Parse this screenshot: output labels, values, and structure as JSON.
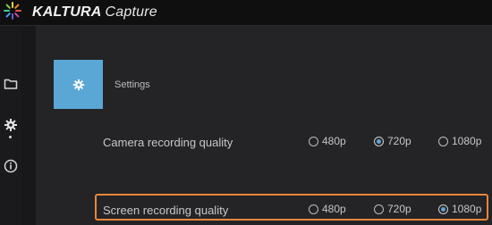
{
  "app": {
    "brand_name": "KALTURA",
    "brand_product": "Capture",
    "colors": {
      "accent": "#5aa7d6",
      "highlight": "#e8863a",
      "background": "#242426"
    }
  },
  "sidebar": {
    "items": [
      {
        "icon": "folder-icon",
        "active": false
      },
      {
        "icon": "gear-icon",
        "active": true
      },
      {
        "icon": "info-icon",
        "active": false
      }
    ]
  },
  "settings": {
    "title": "Settings",
    "icon": "gear-icon",
    "rows": [
      {
        "label": "Camera recording quality",
        "options": [
          {
            "label": "480p",
            "selected": false
          },
          {
            "label": "720p",
            "selected": true
          },
          {
            "label": "1080p",
            "selected": false
          }
        ],
        "highlighted": false
      },
      {
        "label": "Screen recording quality",
        "options": [
          {
            "label": "480p",
            "selected": false
          },
          {
            "label": "720p",
            "selected": false
          },
          {
            "label": "1080p",
            "selected": true
          }
        ],
        "highlighted": true
      }
    ]
  }
}
